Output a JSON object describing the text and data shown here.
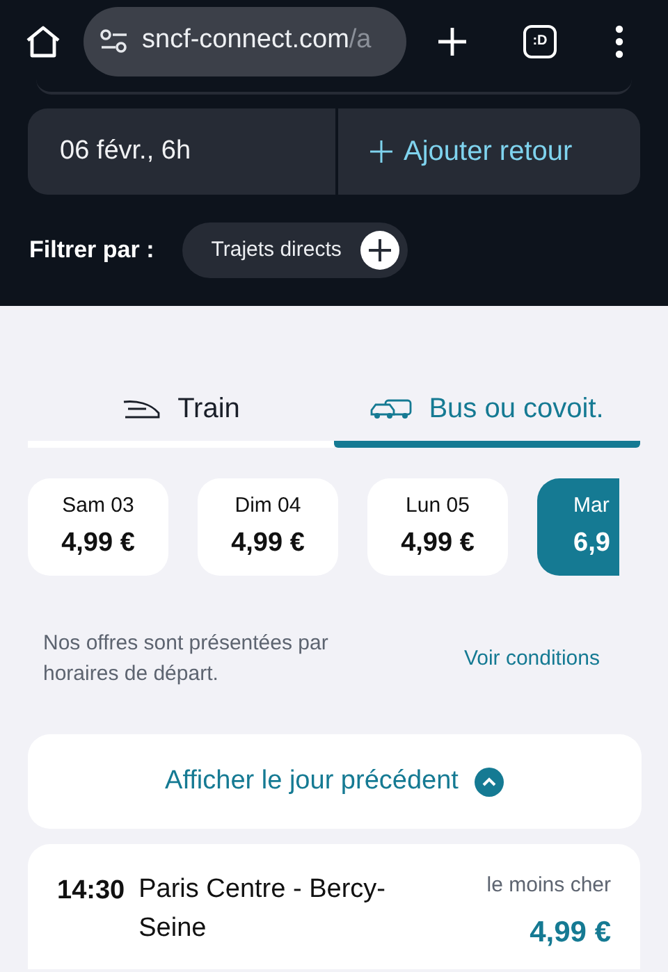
{
  "browser": {
    "url_domain": "sncf-connect.com",
    "url_path": "/a",
    "tab_count_label": ":D"
  },
  "search": {
    "date": "06 févr., 6h",
    "add_return": "Ajouter retour"
  },
  "filter": {
    "label": "Filtrer par :",
    "chips": [
      {
        "label": "Trajets directs",
        "active": false
      }
    ]
  },
  "modes": [
    {
      "label": "Train",
      "kind": "train",
      "selected": false
    },
    {
      "label": "Bus ou covoit.",
      "kind": "bus",
      "selected": true
    }
  ],
  "days": [
    {
      "day": "Sam 03",
      "price": "4,99 €",
      "selected": false
    },
    {
      "day": "Dim 04",
      "price": "4,99 €",
      "selected": false
    },
    {
      "day": "Lun 05",
      "price": "4,99 €",
      "selected": false
    },
    {
      "day": "Mar",
      "price": "6,9",
      "selected": true
    }
  ],
  "info": {
    "text": "Nos offres sont présentées par horaires de départ.",
    "link": "Voir conditions"
  },
  "previous_day": "Afficher le jour précédent",
  "results": [
    {
      "time": "14:30",
      "station": "Paris Centre - Bercy-Seine",
      "price_label": "le moins cher",
      "price": "4,99 €"
    }
  ]
}
